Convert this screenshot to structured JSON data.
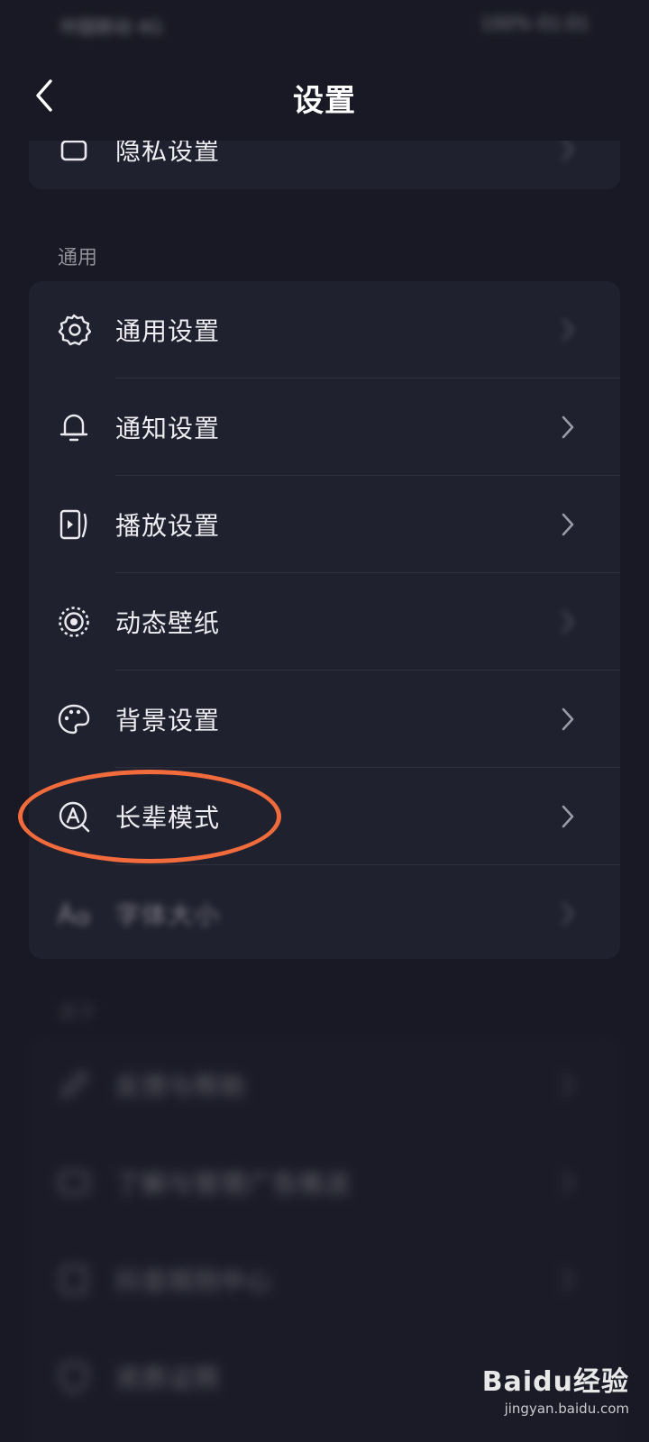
{
  "status_bar": {
    "carrier": "中国移动 4G",
    "right_info": "100% 01:01"
  },
  "header": {
    "title": "设置"
  },
  "top_card": {
    "label": "隐私设置"
  },
  "general_section": {
    "title": "通用",
    "items": [
      {
        "label": "通用设置",
        "icon": "gear-icon"
      },
      {
        "label": "通知设置",
        "icon": "bell-icon"
      },
      {
        "label": "播放设置",
        "icon": "play-device-icon"
      },
      {
        "label": "动态壁纸",
        "icon": "dynamic-wallpaper-icon"
      },
      {
        "label": "背景设置",
        "icon": "palette-icon"
      },
      {
        "label": "长辈模式",
        "icon": "elder-mode-icon"
      },
      {
        "label": "字体大小",
        "icon": "font-size-icon"
      }
    ]
  },
  "about_section": {
    "title": "关于",
    "items": [
      {
        "label": "反馈与帮助",
        "icon": "feedback-icon"
      },
      {
        "label": "了解与管理广告推送",
        "icon": "ad-icon"
      },
      {
        "label": "抖音规则中心",
        "icon": "rules-icon"
      },
      {
        "label": "资质证照",
        "icon": "shield-icon"
      }
    ]
  },
  "highlight_color": "#f26b3c",
  "watermark": {
    "brand": "Baidu经验",
    "url": "jingyan.baidu.com"
  }
}
